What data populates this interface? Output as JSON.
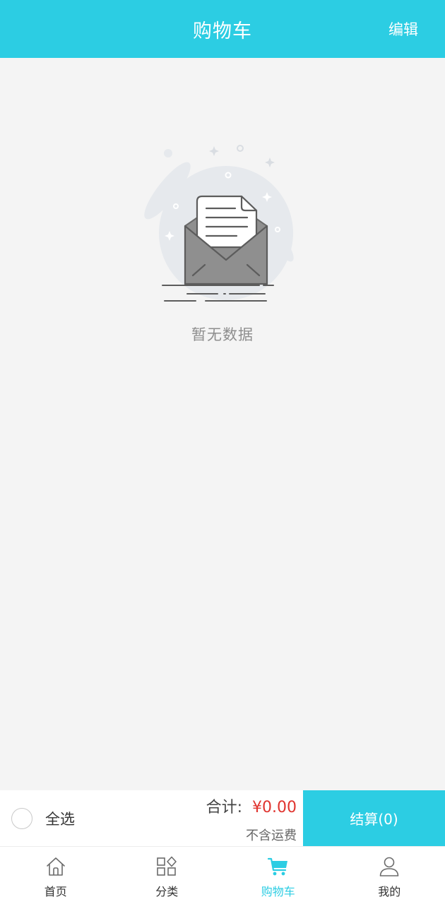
{
  "header": {
    "title": "购物车",
    "edit_label": "编辑"
  },
  "empty_state": {
    "message": "暂无数据"
  },
  "checkout": {
    "select_all_label": "全选",
    "total_label": "合计:",
    "total_price": "¥0.00",
    "shipping_note": "不含运费",
    "checkout_button_label": "结算(0)"
  },
  "tabbar": {
    "items": [
      {
        "label": "首页",
        "icon": "home-icon",
        "active": false
      },
      {
        "label": "分类",
        "icon": "category-icon",
        "active": false
      },
      {
        "label": "购物车",
        "icon": "cart-icon",
        "active": true
      },
      {
        "label": "我的",
        "icon": "user-icon",
        "active": false
      }
    ]
  },
  "colors": {
    "accent": "#2ccde3",
    "price": "#e0342f",
    "background": "#f4f4f4"
  }
}
